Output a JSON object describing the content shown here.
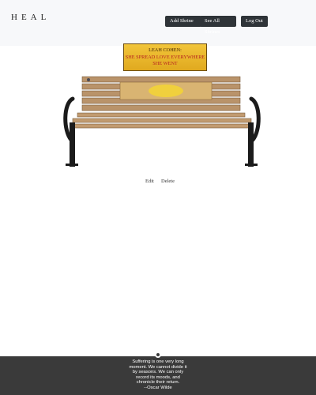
{
  "header": {
    "logo_text": "HEAL",
    "nav": {
      "add_shrine": "Add Shrine",
      "see_all_shrines": "See All Shrines",
      "log_out": "Log Out"
    }
  },
  "shrine": {
    "plaque_name": "LEAH COHEN:",
    "plaque_message": "SHE SPREAD LOVE EVERYWHERE SHE WENT",
    "actions": {
      "edit": "Edit",
      "delete": "Delete"
    }
  },
  "footer": {
    "quote_lines": [
      "Suffering is one very long",
      "moment. We cannot divide it",
      "by seasons. We can only",
      "record its moods, and",
      "chronicle their return.",
      "--Oscar Wilde"
    ],
    "icon": "circle-icon"
  }
}
